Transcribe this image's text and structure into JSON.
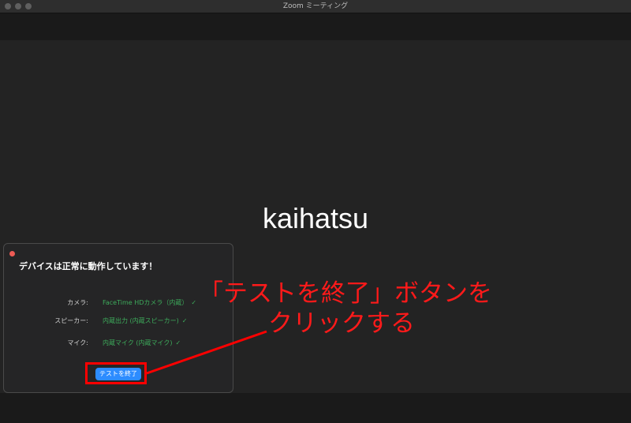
{
  "window": {
    "title": "Zoom ミーティング"
  },
  "participant": {
    "name": "kaihatsu"
  },
  "device_test": {
    "heading": "デバイスは正常に動作しています！",
    "rows": [
      {
        "label": "カメラ:",
        "value": "FaceTime HDカメラ（内蔵）",
        "check": "✓"
      },
      {
        "label": "スピーカー:",
        "value": "内蔵出力 (内蔵スピーカー)",
        "check": "✓"
      },
      {
        "label": "マイク:",
        "value": "内蔵マイク (内蔵マイク)",
        "check": "✓"
      }
    ],
    "end_button": "テストを終了"
  },
  "annotation": {
    "line1": "「テストを終了」ボタンを",
    "line2": "クリックする",
    "color": "#ff0000"
  }
}
